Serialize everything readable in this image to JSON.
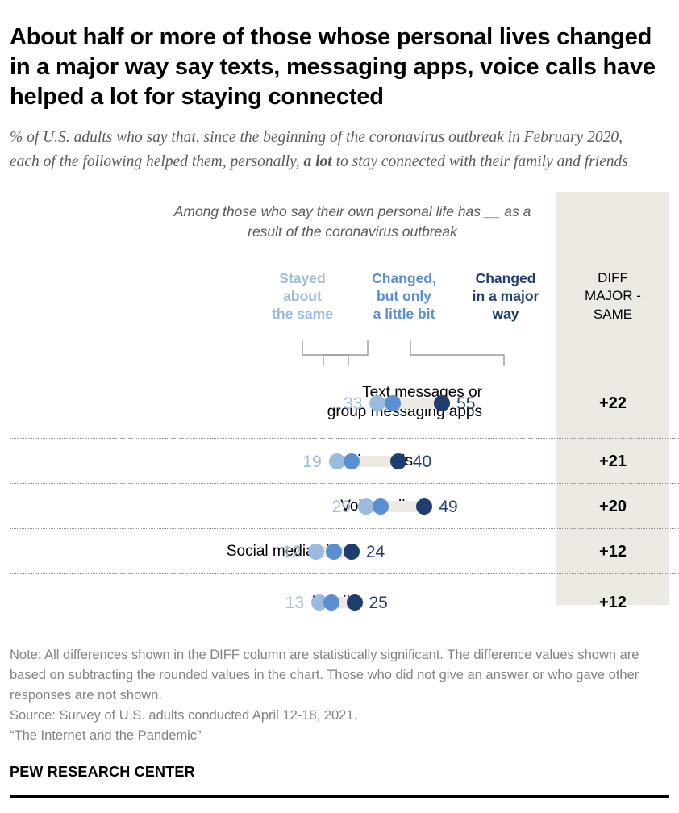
{
  "title": "About half or more of those whose personal lives changed in a major way say texts, messaging apps, voice calls have helped a lot for staying connected",
  "subtitle_part1": "% of U.S. adults who say that, since the beginning of the coronavirus outbreak in February 2020, each of the following helped them, personally, ",
  "subtitle_bold": "a lot",
  "subtitle_part2": " to stay connected with their family and friends",
  "among_caption": "Among those who say their own personal life has __ as a result of the coronavirus outbreak",
  "diff_header": "DIFF MAJOR - SAME",
  "colors": {
    "stayed_same": "#9cb9e0",
    "changed_little": "#5b8fd1",
    "changed_major": "#1f3d6e",
    "track": "#eceae3",
    "panel": "#eceae3",
    "note_text": "#808285",
    "subtitle_text": "#58595b"
  },
  "notes": {
    "note": "Note: All differences shown in the DIFF column are statistically significant. The difference values shown are based on subtracting the rounded values in the chart. Those who did not give an answer or who gave other responses are not shown.",
    "source": "Source: Survey of U.S. adults conducted April 12-18, 2021.",
    "report": "“The Internet and the Pandemic”",
    "brand": "PEW RESEARCH CENTER"
  },
  "chart_data": {
    "type": "bar",
    "chart_subtype": "dumbbell-dot-plot",
    "title": "About half or more of those whose personal lives changed in a major way say texts, messaging apps, voice calls have helped a lot for staying connected",
    "subtitle": "% of U.S. adults who say that, since the beginning of the coronavirus outbreak in February 2020, each of the following helped them, personally, a lot to stay connected with their family and friends",
    "xlabel": "",
    "ylabel": "",
    "xlim": [
      0,
      60
    ],
    "grid": false,
    "legend_position": "top",
    "series": [
      {
        "name": "Stayed about the same",
        "color": "#9cb9e0",
        "values": [
          33,
          19,
          29,
          12,
          13
        ]
      },
      {
        "name": "Changed, but only a little bit",
        "color": "#5b8fd1",
        "values": [
          38,
          24,
          34,
          18,
          17
        ]
      },
      {
        "name": "Changed in a major way",
        "color": "#1f3d6e",
        "values": [
          55,
          40,
          49,
          24,
          25
        ]
      }
    ],
    "categories": [
      "Text messages or group messaging apps",
      "Video calls",
      "Voice calls",
      "Social media sites",
      "Email"
    ],
    "diff_values": [
      "+22",
      "+21",
      "+20",
      "+12",
      "+12"
    ],
    "annotations": {
      "low_labels": [
        "33",
        "19",
        "29",
        "12",
        "13"
      ],
      "high_labels": [
        "55",
        "40",
        "49",
        "24",
        "25"
      ]
    }
  },
  "legend": [
    {
      "label": "Stayed about the same",
      "line1": "Stayed",
      "line2": "about",
      "line3": "the same",
      "color": "#9cb9e0"
    },
    {
      "label": "Changed, but only a little bit",
      "line1": "Changed,",
      "line2": "but only",
      "line3": "a little bit",
      "color": "#5b8fd1"
    },
    {
      "label": "Changed in a major way",
      "line1": "Changed",
      "line2": "in a major",
      "line3": "way",
      "color": "#1f3d6e"
    }
  ],
  "rows": [
    {
      "category_line1": "Text messages or",
      "category_line2": "group messaging apps",
      "low": "33",
      "mid": "38",
      "high": "55",
      "diff": "+22"
    },
    {
      "category_line1": "Video calls",
      "category_line2": "",
      "low": "19",
      "mid": "24",
      "high": "40",
      "diff": "+21"
    },
    {
      "category_line1": "Voice calls",
      "category_line2": "",
      "low": "29",
      "mid": "34",
      "high": "49",
      "diff": "+20"
    },
    {
      "category_line1": "Social media sites",
      "category_line2": "",
      "low": "12",
      "mid": "18",
      "high": "24",
      "diff": "+12"
    },
    {
      "category_line1": "Email",
      "category_line2": "",
      "low": "13",
      "mid": "17",
      "high": "25",
      "diff": "+12"
    }
  ]
}
